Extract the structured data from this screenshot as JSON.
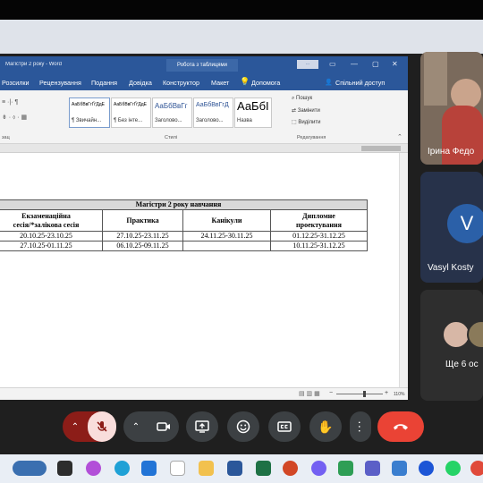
{
  "word": {
    "doc_title": "Магістри 2 року - Word",
    "tools_title": "Робота з таблицями",
    "menu": [
      "Розсилки",
      "Рецензування",
      "Подання",
      "Довідка",
      "Конструктор",
      "Макет"
    ],
    "help": "Допомога",
    "share": "Спільний доступ",
    "styles": [
      {
        "sample": "АаБбВвГгҐґДдЕ",
        "name": "¶ Звичайн..."
      },
      {
        "sample": "АаБбВвГгҐґДдЕ",
        "name": "¶ Без інте..."
      },
      {
        "sample": "АаБбВвГг",
        "name": "Заголово..."
      },
      {
        "sample": "АаБбВвГгД",
        "name": "Заголово..."
      },
      {
        "sample": "АаБбІ",
        "name": "Назва"
      }
    ],
    "groups": {
      "paragraph": "зац",
      "styles": "Стилі",
      "editing": "Редагування"
    },
    "editing": {
      "find": "Пошук",
      "replace": "Замінити",
      "select": "Виділити"
    },
    "zoom": "110%"
  },
  "table": {
    "title": "Магістри 2 року навчання",
    "headers": {
      "exam_line1": "Екзаменаційна",
      "exam_line2": "сесія/*залікова сесія",
      "practice": "Практика",
      "holidays": "Канікули",
      "diploma_line1": "Дипломне",
      "diploma_line2": "проектування"
    },
    "rows": [
      {
        "exam": "20.10.25-23.10.25",
        "practice": "27.10.25-23.11.25",
        "holidays": "24.11.25-30.11.25",
        "diploma": "01.12.25-31.12.25"
      },
      {
        "exam": "27.10.25-01.11.25",
        "practice": "06.10.25-09.11.25",
        "holidays": "",
        "diploma": "10.11.25-31.12.25"
      }
    ]
  },
  "participants": [
    {
      "name": "Ірина Федо"
    },
    {
      "name": "Vasyl Kosty",
      "initial": "V"
    },
    {
      "name": "Ще 6 ос"
    }
  ],
  "colors": {
    "word_blue": "#2b579a",
    "end_call": "#ea4335",
    "mic_off": "#8c1d18",
    "avatar_blue": "#2b60a8"
  }
}
